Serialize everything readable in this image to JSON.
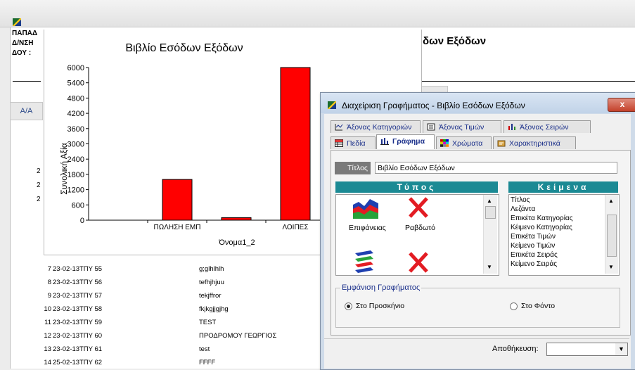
{
  "report": {
    "header_lines": [
      "ΠΑΠΑΔ",
      "Δ/ΝΣΗ",
      "ΔΟΥ :"
    ],
    "title": "δων Εξόδων",
    "col_header": "Α/Α",
    "side_digits": [
      "2",
      "2",
      "2"
    ],
    "rows": [
      {
        "num": "7",
        "date": "23-02-13",
        "type": "ΤΠΥ 55",
        "descr": "g;glhlhlh"
      },
      {
        "num": "8",
        "date": "23-02-13",
        "type": "ΤΠΥ 56",
        "descr": "tefhjhjuu"
      },
      {
        "num": "9",
        "date": "23-02-13",
        "type": "ΤΠΥ 57",
        "descr": "tekjffror"
      },
      {
        "num": "10",
        "date": "23-02-13",
        "type": "ΤΠΥ 58",
        "descr": "fkjkgjjgjhg"
      },
      {
        "num": "11",
        "date": "23-02-13",
        "type": "ΤΠΥ 59",
        "descr": "TEST"
      },
      {
        "num": "12",
        "date": "23-02-13",
        "type": "ΤΠΥ 60",
        "descr": "ΠΡΟΔΡΟΜΟΥ ΓΕΩΡΓΙΟΣ"
      },
      {
        "num": "13",
        "date": "23-02-13",
        "type": "ΤΠΥ 61",
        "descr": "test"
      },
      {
        "num": "14",
        "date": "25-02-13",
        "type": "ΤΠΥ 62",
        "descr": "FFFF"
      }
    ]
  },
  "chart_data": {
    "type": "bar",
    "title": "Βιβλίο Εσόδων Εξόδων",
    "xlabel": "Όνομα1_2",
    "ylabel": "Συνολική Αξία",
    "categories": [
      "",
      "ΠΩΛΗΣΗ ΕΜΠ",
      "",
      "ΛΟΙΠΕΣ"
    ],
    "values": [
      0,
      1600,
      100,
      6000
    ],
    "yticks": [
      0,
      600,
      1200,
      1800,
      2400,
      3000,
      3600,
      4200,
      4800,
      5400,
      6000
    ],
    "ylim": [
      0,
      6000
    ],
    "bar_color": "#ff0000"
  },
  "dialog": {
    "title": "Διαχείριση Γραφήματος - Βιβλίο Εσόδων Εξόδων",
    "close_label": "x",
    "tabs_row1": [
      "Άξονας Κατηγοριών",
      "Άξονας Τιμών",
      "Άξονας Σειρών"
    ],
    "tabs_row2": [
      "Πεδία",
      "Γράφημα",
      "Χρώματα",
      "Χαρακτηριστικά"
    ],
    "titlos_label": "Τίτλος",
    "titlos_value": "Βιβλίο Εσόδων Εξόδων",
    "typos_header": "Τύπος",
    "keimena_header": "Κείμενα",
    "chart_types": [
      "Επιφάνειας",
      "Ραβδωτό"
    ],
    "text_items": [
      "Τίτλος",
      "Λεζάντα",
      "Επικέτα Κατηγορίας",
      "Κέιμενο Κατηγορίας",
      "Επικέτα Τιμών",
      "Κείμενο Τιμών",
      "Επικέτα Σειράς",
      "Κείμενο Σειράς"
    ],
    "display_group": "Εμφάνιση Γραφήματος",
    "radio_front": "Στο Προσκήνιο",
    "radio_back": "Στο Φόντο",
    "save_label": "Αποθήκευση:"
  }
}
